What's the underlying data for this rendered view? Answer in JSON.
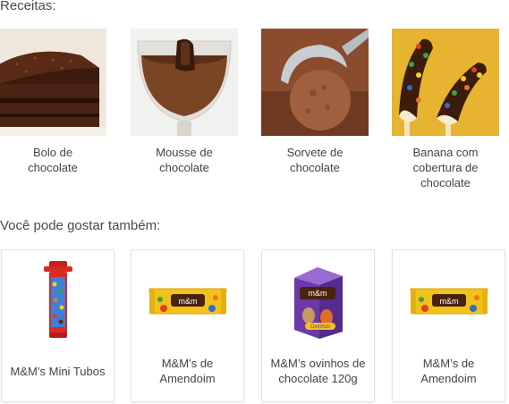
{
  "recipes": {
    "title": "Receitas:",
    "items": [
      {
        "label": "Bolo de chocolate"
      },
      {
        "label": "Mousse de chocolate"
      },
      {
        "label": "Sorvete de chocolate"
      },
      {
        "label": "Banana com cobertura de chocolate"
      }
    ]
  },
  "suggestions": {
    "title": "Você pode gostar também:",
    "items": [
      {
        "label": "M&M’s Mini Tubos"
      },
      {
        "label": "M&M’s de Amendoim"
      },
      {
        "label": "M&M’s ovinhos de chocolate 120g"
      },
      {
        "label": "M&M’s de Amendoim"
      }
    ]
  },
  "product_logo_text": "m&m",
  "product_badge_text": "Ovinhos"
}
